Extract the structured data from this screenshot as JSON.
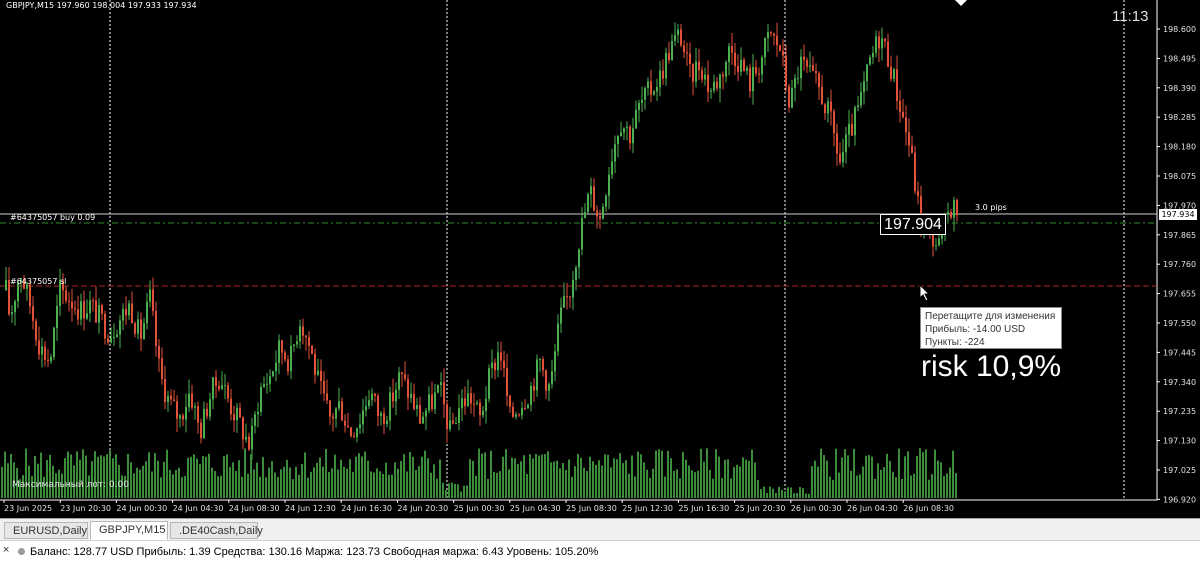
{
  "header": {
    "symbol_info": "GBPJPY,M15  197.960 198.004 197.933 197.934",
    "clock": "11:13"
  },
  "colors": {
    "background": "#000000",
    "bull": "#4caf50",
    "bear": "#e2513a",
    "volume": "#3c8c3c",
    "grid": "#ffffff",
    "order_line": "#2e8b2e",
    "stop_line": "#b22222"
  },
  "price_axis": [
    "198.600",
    "198.495",
    "198.390",
    "198.285",
    "198.180",
    "198.075",
    "197.970",
    "197.865",
    "197.760",
    "197.655",
    "197.550",
    "197.445",
    "197.340",
    "197.235",
    "197.130",
    "197.025",
    "196.920"
  ],
  "time_axis": [
    "23 Jun 2025",
    "23 Jun 20:30",
    "24 Jun 00:30",
    "24 Jun 04:30",
    "24 Jun 08:30",
    "24 Jun 12:30",
    "24 Jun 16:30",
    "24 Jun 20:30",
    "25 Jun 00:30",
    "25 Jun 04:30",
    "25 Jun 08:30",
    "25 Jun 12:30",
    "25 Jun 16:30",
    "25 Jun 20:30",
    "26 Jun 00:30",
    "26 Jun 04:30",
    "26 Jun 08:30"
  ],
  "bid_price": "197.934",
  "big_price": "197.904",
  "order_line_label": "#64375057 buy 0.09",
  "stop_line_label": "#64375057 sl",
  "pips_label": "3.0 pips",
  "max_lot": "Максимальный лот: 0.00",
  "tooltip": {
    "line1": "Перетащите для изменения",
    "line2": "Прибыль: -14.00 USD",
    "line3": "Пункты: -224"
  },
  "overlay_text": "risk 10,9%",
  "tabs": [
    {
      "label": "EURUSD,Daily",
      "active": false
    },
    {
      "label": "GBPJPY,M15",
      "active": true
    },
    {
      "label": ".DE40Cash,Daily",
      "active": false
    }
  ],
  "status": {
    "text": "Баланс: 128.77 USD  Прибыль: 1.39  Средства: 130.16  Маржа: 123.73  Свободная маржа: 6.43  Уровень: 105.20%"
  },
  "chart_data": {
    "type": "candlestick",
    "symbol": "GBPJPY",
    "timeframe": "M15",
    "ylim": [
      196.92,
      198.64
    ],
    "path_points": [
      [
        0,
        197.8
      ],
      [
        10,
        197.55
      ],
      [
        20,
        197.72
      ],
      [
        30,
        197.6
      ],
      [
        40,
        197.45
      ],
      [
        50,
        197.4
      ],
      [
        60,
        197.65
      ],
      [
        70,
        197.62
      ],
      [
        80,
        197.58
      ],
      [
        90,
        197.6
      ],
      [
        100,
        197.55
      ],
      [
        110,
        197.5
      ],
      [
        120,
        197.55
      ],
      [
        130,
        197.6
      ],
      [
        140,
        197.48
      ],
      [
        150,
        197.62
      ],
      [
        160,
        197.35
      ],
      [
        170,
        197.25
      ],
      [
        180,
        197.2
      ],
      [
        190,
        197.3
      ],
      [
        200,
        197.15
      ],
      [
        210,
        197.28
      ],
      [
        220,
        197.35
      ],
      [
        230,
        197.25
      ],
      [
        240,
        197.18
      ],
      [
        250,
        197.1
      ],
      [
        260,
        197.3
      ],
      [
        270,
        197.35
      ],
      [
        280,
        197.45
      ],
      [
        290,
        197.4
      ],
      [
        300,
        197.55
      ],
      [
        310,
        197.45
      ],
      [
        320,
        197.3
      ],
      [
        330,
        197.2
      ],
      [
        340,
        197.25
      ],
      [
        350,
        197.15
      ],
      [
        360,
        197.2
      ],
      [
        370,
        197.3
      ],
      [
        380,
        197.2
      ],
      [
        390,
        197.25
      ],
      [
        400,
        197.35
      ],
      [
        410,
        197.28
      ],
      [
        420,
        197.2
      ],
      [
        430,
        197.25
      ],
      [
        440,
        197.3
      ],
      [
        450,
        197.15
      ],
      [
        460,
        197.25
      ],
      [
        470,
        197.28
      ],
      [
        480,
        197.2
      ],
      [
        490,
        197.35
      ],
      [
        500,
        197.45
      ],
      [
        510,
        197.2
      ],
      [
        520,
        197.25
      ],
      [
        530,
        197.3
      ],
      [
        540,
        197.4
      ],
      [
        550,
        197.3
      ],
      [
        560,
        197.55
      ],
      [
        570,
        197.65
      ],
      [
        580,
        197.85
      ],
      [
        590,
        198.0
      ],
      [
        600,
        197.9
      ],
      [
        610,
        198.1
      ],
      [
        620,
        198.25
      ],
      [
        630,
        198.2
      ],
      [
        640,
        198.3
      ],
      [
        650,
        198.35
      ],
      [
        660,
        198.4
      ],
      [
        670,
        198.5
      ],
      [
        680,
        198.55
      ],
      [
        690,
        198.4
      ],
      [
        700,
        198.45
      ],
      [
        710,
        198.35
      ],
      [
        720,
        198.4
      ],
      [
        730,
        198.5
      ],
      [
        740,
        198.45
      ],
      [
        750,
        198.38
      ],
      [
        760,
        198.45
      ],
      [
        770,
        198.55
      ],
      [
        780,
        198.5
      ],
      [
        790,
        198.3
      ],
      [
        800,
        198.45
      ],
      [
        810,
        198.4
      ],
      [
        820,
        198.35
      ],
      [
        830,
        198.25
      ],
      [
        840,
        198.1
      ],
      [
        850,
        198.2
      ],
      [
        860,
        198.3
      ],
      [
        870,
        198.45
      ],
      [
        880,
        198.55
      ],
      [
        890,
        198.45
      ],
      [
        900,
        198.3
      ],
      [
        910,
        198.15
      ],
      [
        920,
        197.9
      ],
      [
        930,
        197.85
      ],
      [
        940,
        197.8
      ],
      [
        950,
        197.95
      ],
      [
        958,
        197.93
      ]
    ],
    "lines": {
      "bid": 197.934,
      "order_open": 197.904,
      "stop_loss": 197.68
    }
  }
}
